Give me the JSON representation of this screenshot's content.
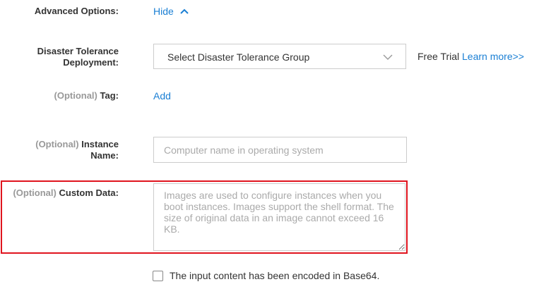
{
  "advanced_options": {
    "label": "Advanced Options:",
    "toggle_label": "Hide"
  },
  "disaster_tolerance": {
    "label_line1": "Disaster Tolerance",
    "label_line2": "Deployment:",
    "selected_value": "Select Disaster Tolerance Group",
    "free_trial_text": "Free Trial",
    "learn_more_link": "Learn more>>"
  },
  "tag": {
    "optional_prefix": "(Optional)",
    "label": "Tag:",
    "add_link": "Add"
  },
  "instance_name": {
    "optional_prefix": "(Optional)",
    "label_line1": "Instance",
    "label_line2": "Name:",
    "placeholder": "Computer name in operating system",
    "value": ""
  },
  "custom_data": {
    "optional_prefix": "(Optional)",
    "label": "Custom Data:",
    "placeholder": "Images are used to configure instances when you boot instances. Images support the shell format. The size of original data in an image cannot exceed 16 KB.",
    "value": ""
  },
  "base64_checkbox": {
    "label": "The input content has been encoded in Base64.",
    "checked": false
  },
  "colors": {
    "link": "#1a7fd4",
    "highlight_border": "#e0141e",
    "optional_text": "#999999"
  }
}
